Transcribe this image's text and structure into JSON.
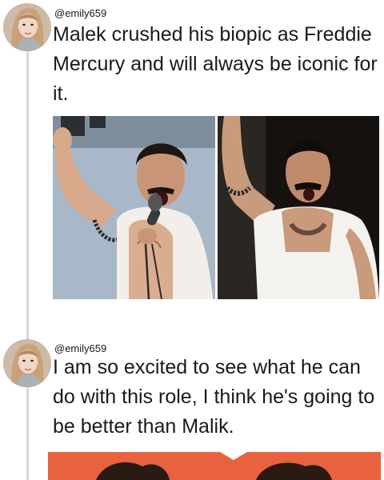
{
  "tweets": [
    {
      "handle": "@emily659",
      "text": "Malek crushed his biopic as Freddie Mercury and will always be iconic for it."
    },
    {
      "handle": "@emily659",
      "text": "I am so excited to see what he can do with this role, I think he's going to be better than Malik."
    }
  ],
  "images": {
    "left_photo": "performer-raising-fist-with-microphone",
    "right_photo": "performer-with-armband-singing"
  },
  "colors": {
    "thread_line": "#d5d9dd",
    "text": "#1a1a1a",
    "banner": "#e9623f"
  }
}
